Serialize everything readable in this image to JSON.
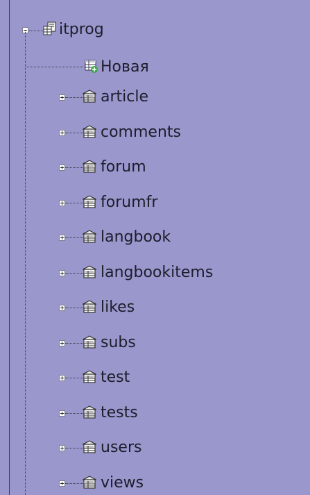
{
  "tree": {
    "root": {
      "label": "itprog",
      "icon": "database-icon",
      "expanded": true
    },
    "new_item": {
      "label": "Новая",
      "icon": "new-table-icon"
    },
    "tables": [
      {
        "label": "article",
        "icon": "table-icon",
        "expanded": false
      },
      {
        "label": "comments",
        "icon": "table-icon",
        "expanded": false
      },
      {
        "label": "forum",
        "icon": "table-icon",
        "expanded": false
      },
      {
        "label": "forumfr",
        "icon": "table-icon",
        "expanded": false
      },
      {
        "label": "langbook",
        "icon": "table-icon",
        "expanded": false
      },
      {
        "label": "langbookitems",
        "icon": "table-icon",
        "expanded": false
      },
      {
        "label": "likes",
        "icon": "table-icon",
        "expanded": false
      },
      {
        "label": "subs",
        "icon": "table-icon",
        "expanded": false
      },
      {
        "label": "test",
        "icon": "table-icon",
        "expanded": false
      },
      {
        "label": "tests",
        "icon": "table-icon",
        "expanded": false
      },
      {
        "label": "users",
        "icon": "table-icon",
        "expanded": false
      },
      {
        "label": "views",
        "icon": "table-icon",
        "expanded": false
      }
    ]
  },
  "colors": {
    "background": "#9a97cc",
    "text": "#1d1d2c",
    "tree_line": "#3a3a4a"
  }
}
